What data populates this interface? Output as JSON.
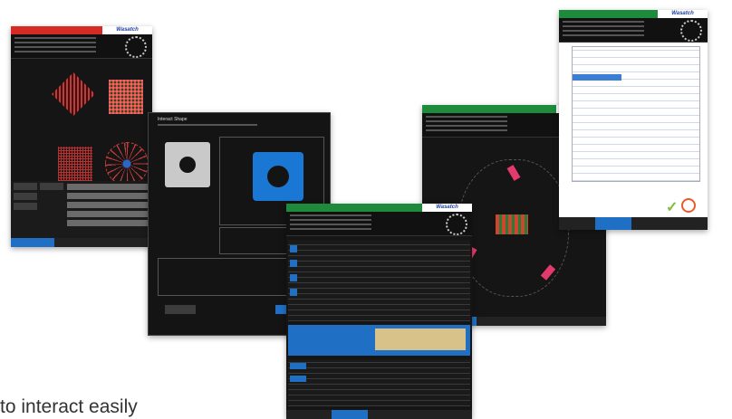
{
  "caption": "to interact easily",
  "brand": "Wasatch",
  "colors": {
    "red_title": "#d62a24",
    "green_title": "#1e8a3c",
    "blue_button": "#1f6fc5",
    "blueprint": "#1a78d4"
  },
  "screens": {
    "pattern_screen": {
      "title_color": "#d62a24"
    },
    "interact_dialog": {
      "title": "Interact Shape"
    },
    "orientation_screen": {
      "title_color": "#1e8a3c"
    },
    "table_screen": {
      "title_color": "#1e8a3c"
    },
    "job_screen": {
      "title_color": "#1e8a3c"
    }
  }
}
